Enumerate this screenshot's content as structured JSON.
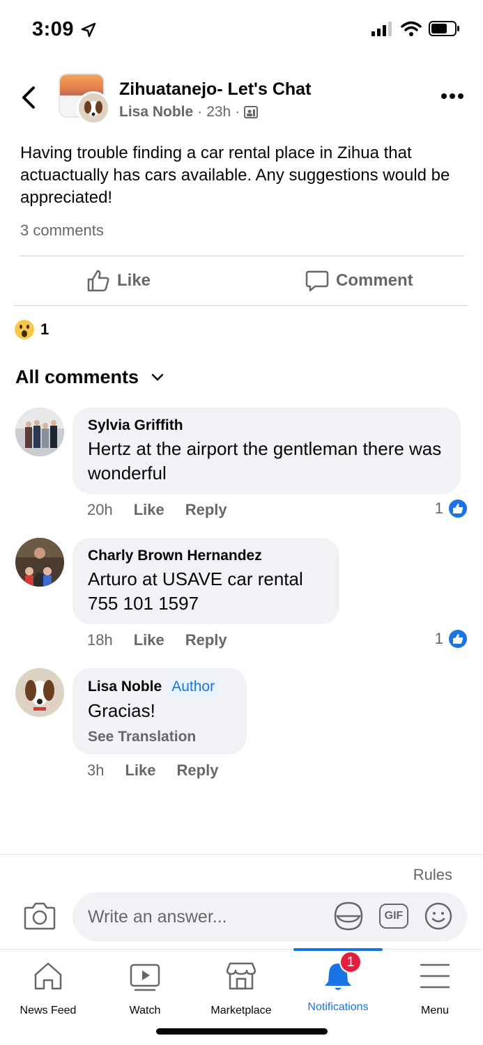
{
  "status_bar": {
    "time": "3:09"
  },
  "post": {
    "group_name": "Zihuatanejo- Let's Chat",
    "author": "Lisa Noble",
    "time": "23h",
    "body": "Having trouble finding a car rental place in Zihua that actuactually has cars available. Any suggestions would be appreciated!",
    "comment_count": "3 comments",
    "actions": {
      "like": "Like",
      "comment": "Comment"
    },
    "reaction_count": "1"
  },
  "comments_header": "All comments",
  "comments": [
    {
      "name": "Sylvia Griffith",
      "text": "Hertz at the airport the gentleman there was wonderful",
      "time": "20h",
      "like": "Like",
      "reply": "Reply",
      "reactions": "1"
    },
    {
      "name": "Charly Brown Hernandez",
      "text": "Arturo at USAVE car rental 755 101 1597",
      "time": "18h",
      "like": "Like",
      "reply": "Reply",
      "reactions": "1"
    },
    {
      "name": "Lisa Noble",
      "badge": "Author",
      "text": "Gracias!",
      "see_translation": "See Translation",
      "time": "3h",
      "like": "Like",
      "reply": "Reply"
    }
  ],
  "composer": {
    "rules": "Rules",
    "placeholder": "Write an answer...",
    "gif": "GIF"
  },
  "tabs": [
    {
      "label": "News Feed",
      "icon": "home-icon"
    },
    {
      "label": "Watch",
      "icon": "watch-icon"
    },
    {
      "label": "Marketplace",
      "icon": "marketplace-icon"
    },
    {
      "label": "Notifications",
      "icon": "bell-icon",
      "badge": "1",
      "active": true
    },
    {
      "label": "Menu",
      "icon": "menu-icon"
    }
  ],
  "colors": {
    "accent": "#1b74e4",
    "badge": "#e41e3f",
    "secondary_text": "#65676b",
    "bubble": "#f0f2f5"
  }
}
